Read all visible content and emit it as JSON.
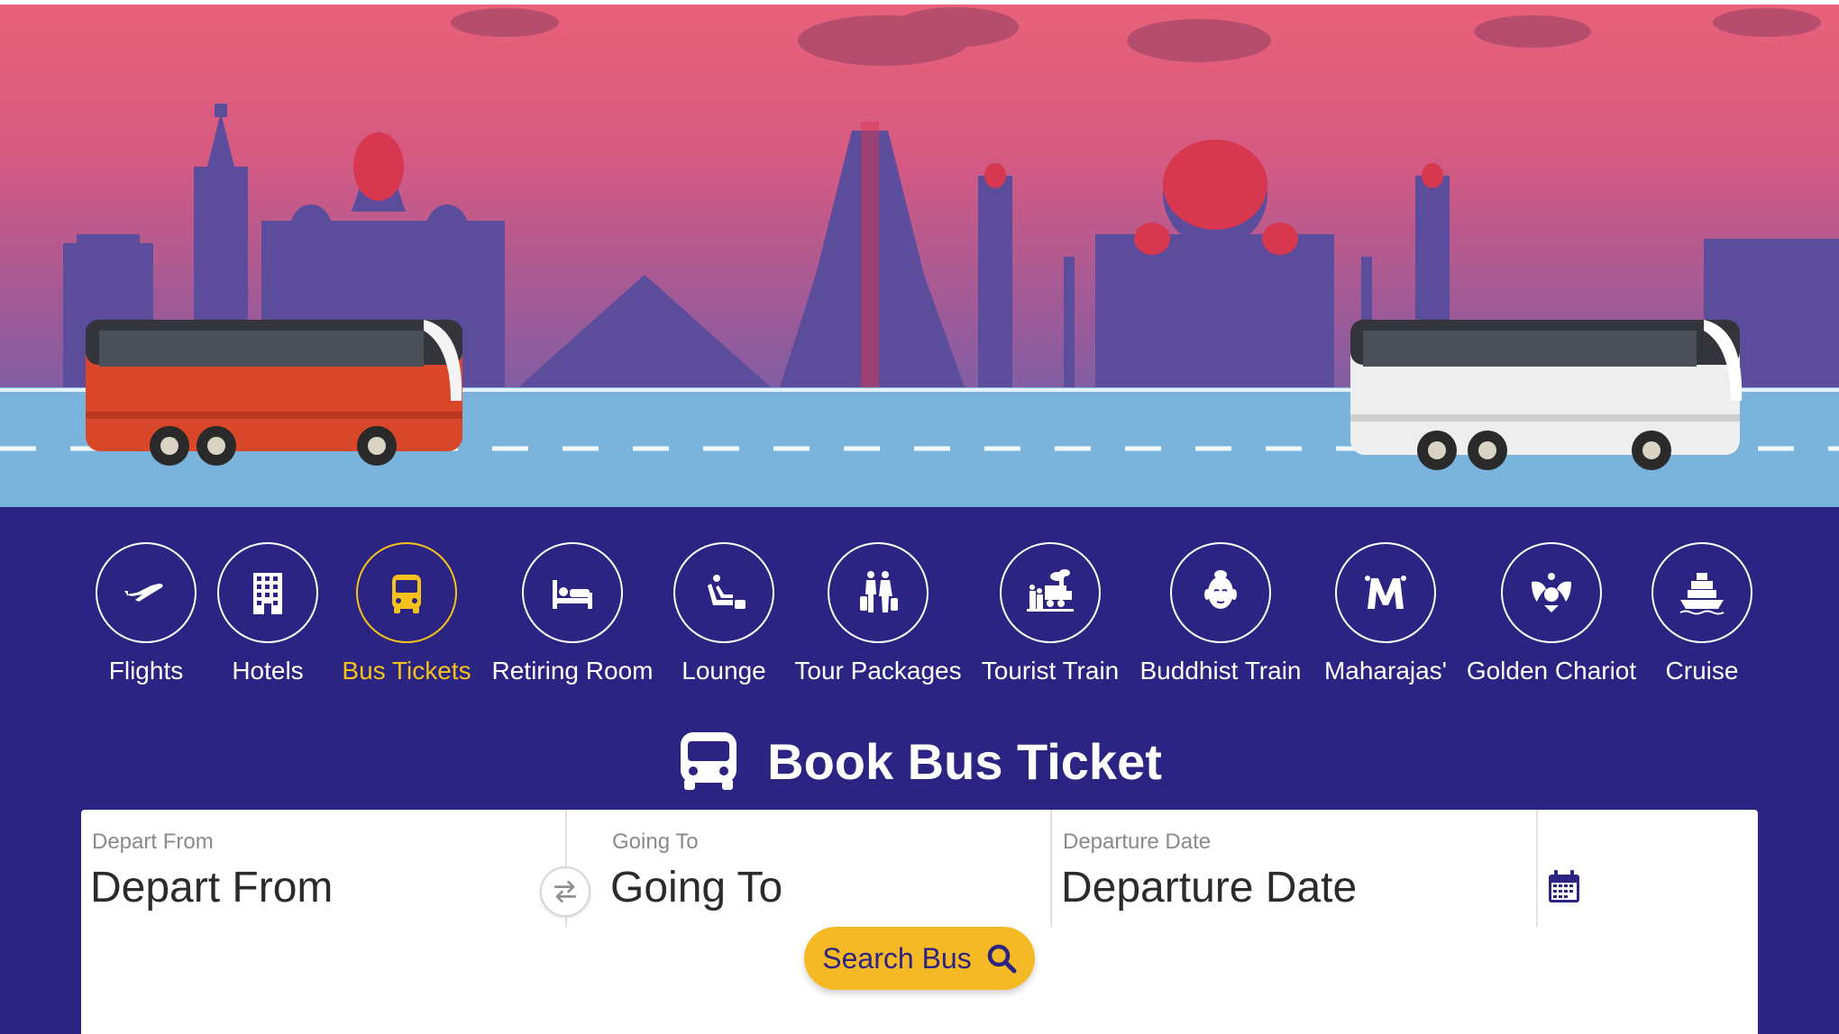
{
  "nav": {
    "items": [
      {
        "label": "Flights",
        "icon": "airplane-icon"
      },
      {
        "label": "Hotels",
        "icon": "building-icon"
      },
      {
        "label": "Bus Tickets",
        "icon": "bus-icon",
        "active": true
      },
      {
        "label": "Retiring Room",
        "icon": "bed-icon"
      },
      {
        "label": "Lounge",
        "icon": "lounge-chair-icon"
      },
      {
        "label": "Tour Packages",
        "icon": "travellers-icon"
      },
      {
        "label": "Tourist Train",
        "icon": "steam-train-icon"
      },
      {
        "label": "Buddhist Train",
        "icon": "buddha-icon"
      },
      {
        "label": "Maharajas'",
        "icon": "maharajas-logo-icon"
      },
      {
        "label": "Golden Chariot",
        "icon": "golden-chariot-icon"
      },
      {
        "label": "Cruise",
        "icon": "ship-icon"
      }
    ],
    "active_color": "#f5c21b"
  },
  "booking": {
    "title": "Book Bus Ticket",
    "depart": {
      "label": "Depart From",
      "placeholder": "Depart From"
    },
    "going": {
      "label": "Going To",
      "placeholder": "Going To"
    },
    "date": {
      "label": "Departure Date",
      "placeholder": "Departure Date"
    },
    "search_label": "Search Bus"
  },
  "colors": {
    "band": "#2c2482",
    "search_button": "#f4b924",
    "sky_top": "#e86178",
    "road": "#7ab4dc"
  }
}
